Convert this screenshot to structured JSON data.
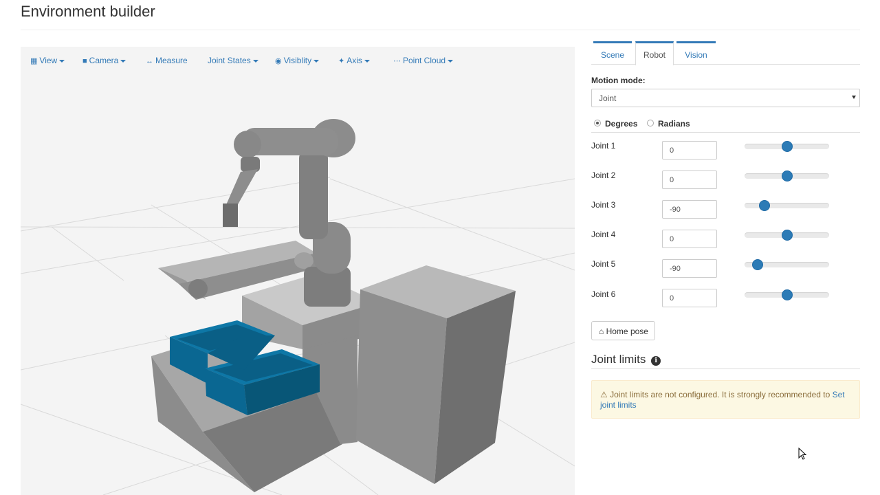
{
  "page": {
    "title": "Environment builder"
  },
  "toolbar": {
    "items": [
      {
        "label": "View",
        "icon": "cube-icon"
      },
      {
        "label": "Camera",
        "icon": "video-camera-icon"
      },
      {
        "label": "Measure",
        "icon": "arrows-h-icon"
      },
      {
        "label": "Joint States",
        "icon": ""
      },
      {
        "label": "Visiblity",
        "icon": "eye-icon"
      },
      {
        "label": "Axis",
        "icon": "axis-icon"
      },
      {
        "label": "Point Cloud",
        "icon": "ellipsis-icon"
      }
    ]
  },
  "tabs": [
    {
      "label": "Scene",
      "active": false
    },
    {
      "label": "Robot",
      "active": true
    },
    {
      "label": "Vision",
      "active": false
    }
  ],
  "motion": {
    "label": "Motion mode:",
    "value": "Joint"
  },
  "units": {
    "degrees": "Degrees",
    "radians": "Radians",
    "selected": "Degrees"
  },
  "joints": [
    {
      "label": "Joint 1",
      "value": "0",
      "slider_fraction": 0.5
    },
    {
      "label": "Joint 2",
      "value": "0",
      "slider_fraction": 0.5
    },
    {
      "label": "Joint 3",
      "value": "-90",
      "slider_fraction": 0.2
    },
    {
      "label": "Joint 4",
      "value": "0",
      "slider_fraction": 0.5
    },
    {
      "label": "Joint 5",
      "value": "-90",
      "slider_fraction": 0.1
    },
    {
      "label": "Joint 6",
      "value": "0",
      "slider_fraction": 0.5
    }
  ],
  "home_button": {
    "label": "Home pose",
    "icon": "home-icon"
  },
  "joint_limits": {
    "heading": "Joint limits",
    "warning_text": "Joint limits are not configured. It is strongly recommended to",
    "link_text": "Set joint limits",
    "link_text_2": "joint limits"
  },
  "colors": {
    "accent": "#337ab7",
    "slider_thumb": "#2c7bb6",
    "warning_bg": "#fcf8e3",
    "warning_text": "#8a6d3b",
    "bin_blue": "#0b6a94",
    "robot_gray": "#7d7d7d"
  }
}
